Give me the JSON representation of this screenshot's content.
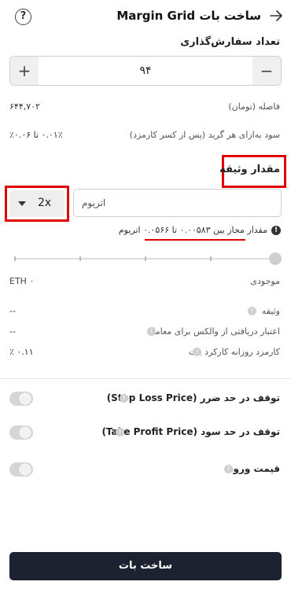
{
  "header": {
    "title": "ساخت بات Margin Grid"
  },
  "order_count": {
    "label": "تعداد سفارش‌گذاری",
    "value": "۹۴",
    "plus": "+",
    "minus": "−"
  },
  "stats": {
    "distance_label": "فاصله (تومان)",
    "distance_value": "۶۴۴,۷۰۲",
    "profit_label": "سود به‌ازای هر گرید (پس از کسر کارمزد)",
    "profit_value": "۰.۰۱٪ تا ۰.۰۶٪"
  },
  "collateral": {
    "title": "مقدار وثیقه",
    "placeholder": "اتریوم",
    "leverage": "2x",
    "range_text": "مقدار مجاز بین ۰.۰۰۵۸۳ تا ۰.۰۵۶۶ اتریوم",
    "slider_level": 0
  },
  "balance": {
    "label": "موجودی",
    "value": "ETH ۰"
  },
  "details": [
    {
      "label": "وثیقه",
      "value": "--"
    },
    {
      "label": "اعتبار دریافتی از والکس برای معامله",
      "value": "--"
    },
    {
      "label": "کارمزد روزانه کارکرد بات",
      "value": "۰.۱۱ ٪"
    }
  ],
  "toggles": [
    {
      "label": "توقف در حد ضرر (Stop Loss Price)",
      "on": false
    },
    {
      "label": "توقف در حد سود (Take Profit Price)",
      "on": false
    },
    {
      "label": "قیمت ورود",
      "on": false
    }
  ],
  "submit_label": "ساخت بات",
  "colors": {
    "highlight_red": "#e00000",
    "primary_dark": "#1c2230",
    "stepper_bg": "#f0f0f0"
  }
}
